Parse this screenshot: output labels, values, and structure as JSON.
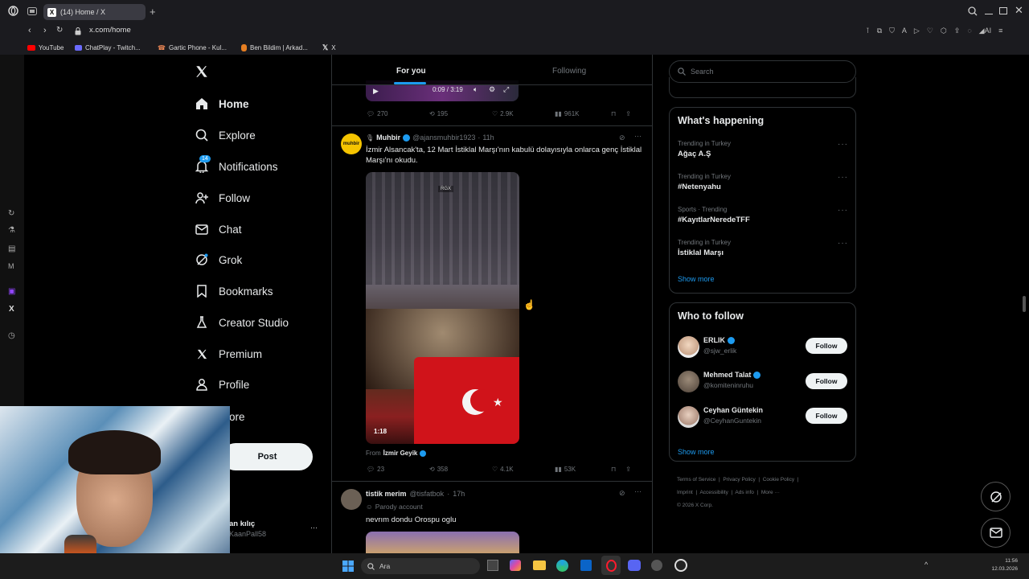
{
  "browser": {
    "tab_title": "(14) Home / X",
    "url": "x.com/home",
    "bookmarks": [
      "YouTube",
      "ChatPlay - Twitch...",
      "Gartic Phone - Kul...",
      "Ben Bildim | Arkad...",
      "X"
    ]
  },
  "nav": {
    "items": [
      {
        "label": "Home",
        "icon": "home-icon"
      },
      {
        "label": "Explore",
        "icon": "search-icon"
      },
      {
        "label": "Notifications",
        "icon": "bell-icon",
        "badge": "14"
      },
      {
        "label": "Follow",
        "icon": "person-add-icon"
      },
      {
        "label": "Chat",
        "icon": "mail-icon"
      },
      {
        "label": "Grok",
        "icon": "grok-icon"
      },
      {
        "label": "Bookmarks",
        "icon": "bookmark-icon"
      },
      {
        "label": "Creator Studio",
        "icon": "flask-icon"
      },
      {
        "label": "Premium",
        "icon": "x-icon"
      },
      {
        "label": "Profile",
        "icon": "person-icon"
      },
      {
        "label": "ore",
        "icon": ""
      }
    ],
    "post_label": "Post",
    "account_name": "an kılıç",
    "account_handle": "KaanPall58"
  },
  "feed": {
    "tabs": [
      "For you",
      "Following"
    ],
    "video_time": "0:09 / 3:19",
    "prev_stats": {
      "replies": "270",
      "reposts": "195",
      "likes": "2.9K",
      "views": "961K"
    },
    "tweet1": {
      "name": "Muhbir",
      "handle": "@ajansmuhbir1923",
      "time": "11h",
      "text": "İzmir Alsancak'ta, 12 Mart İstiklal Marşı'nın kabulü dolayısıyla onlarca genç İstiklal Marşı'nı okudu.",
      "media_badge": "RGX",
      "duration": "1:18",
      "from_label": "From",
      "from_name": "İzmir Geyik",
      "stats": {
        "replies": "23",
        "reposts": "358",
        "likes": "4.1K",
        "views": "53K"
      }
    },
    "tweet2": {
      "name": "tistik merim",
      "handle": "@tisfatbok",
      "time": "17h",
      "parody": "Parody account",
      "text": "nevrım dondu Orospu oglu"
    }
  },
  "right": {
    "search_placeholder": "Search",
    "happening_title": "What's happening",
    "trends": [
      {
        "meta": "Trending in Turkey",
        "name": "Ağaç A.Ş"
      },
      {
        "meta": "Trending in Turkey",
        "name": "#Netenyahu"
      },
      {
        "meta": "Sports · Trending",
        "name": "#KayıtlarNeredeTFF"
      },
      {
        "meta": "Trending in Turkey",
        "name": "İstiklal Marşı"
      }
    ],
    "show_more": "Show more",
    "wtf_title": "Who to follow",
    "follow_label": "Follow",
    "suggestions": [
      {
        "name": "ERLIK",
        "handle": "@sjw_erlik"
      },
      {
        "name": "Mehmed Talat",
        "handle": "@komiteninruhu"
      },
      {
        "name": "Ceyhan Güntekin",
        "handle": "@CeyhanGuntekin"
      }
    ],
    "footer": [
      "Terms of Service",
      "Privacy Policy",
      "Cookie Policy",
      "Imprint",
      "Accessibility",
      "Ads info",
      "More ···",
      "© 2026 X Corp."
    ]
  },
  "taskbar": {
    "search_placeholder": "Ara",
    "time": "11:56",
    "date": "12.03.2026"
  },
  "colors": {
    "accent": "#1d9bf0",
    "background": "#000000",
    "border": "#2f3336"
  }
}
